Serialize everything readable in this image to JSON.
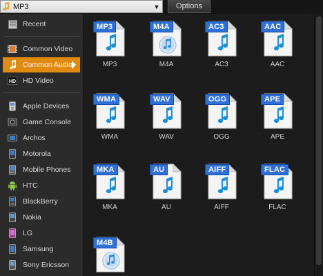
{
  "toolbar": {
    "format_value": "MP3",
    "options_label": "Options"
  },
  "sidebar": {
    "items": [
      {
        "label": "Recent",
        "icon": "recent-icon"
      },
      {
        "label": "Common Video",
        "icon": "film-icon"
      },
      {
        "label": "Common Audio",
        "icon": "music-note-icon",
        "active": true
      },
      {
        "label": "HD Video",
        "icon": "hd-icon"
      },
      {
        "label": "Apple Devices",
        "icon": "ipod-icon"
      },
      {
        "label": "Game Console",
        "icon": "gamepad-icon"
      },
      {
        "label": "Archos",
        "icon": "archos-icon"
      },
      {
        "label": "Motorola",
        "icon": "phone-icon"
      },
      {
        "label": "Mobile Phones",
        "icon": "phone-icon"
      },
      {
        "label": "HTC",
        "icon": "android-icon"
      },
      {
        "label": "BlackBerry",
        "icon": "blackberry-icon"
      },
      {
        "label": "Nokia",
        "icon": "phone-icon"
      },
      {
        "label": "LG",
        "icon": "phone-icon"
      },
      {
        "label": "Samsung",
        "icon": "phone-icon"
      },
      {
        "label": "Sony Ericsson",
        "icon": "phone-icon"
      }
    ]
  },
  "formats": [
    {
      "badge": "MP3",
      "label": "MP3"
    },
    {
      "badge": "M4A",
      "label": "M4A"
    },
    {
      "badge": "AC3",
      "label": "AC3"
    },
    {
      "badge": "AAC",
      "label": "AAC"
    },
    {
      "badge": "WMA",
      "label": "WMA"
    },
    {
      "badge": "WAV",
      "label": "WAV"
    },
    {
      "badge": "OGG",
      "label": "OGG"
    },
    {
      "badge": "APE",
      "label": "APE"
    },
    {
      "badge": "MKA",
      "label": "MKA"
    },
    {
      "badge": "AU",
      "label": "AU"
    },
    {
      "badge": "AIFF",
      "label": "AIFF"
    },
    {
      "badge": "FLAC",
      "label": "FLAC"
    },
    {
      "badge": "M4B",
      "label": ""
    }
  ],
  "colors": {
    "accent": "#e08a10",
    "badge": "#2f6fd6",
    "note": "#1d8fd8"
  }
}
